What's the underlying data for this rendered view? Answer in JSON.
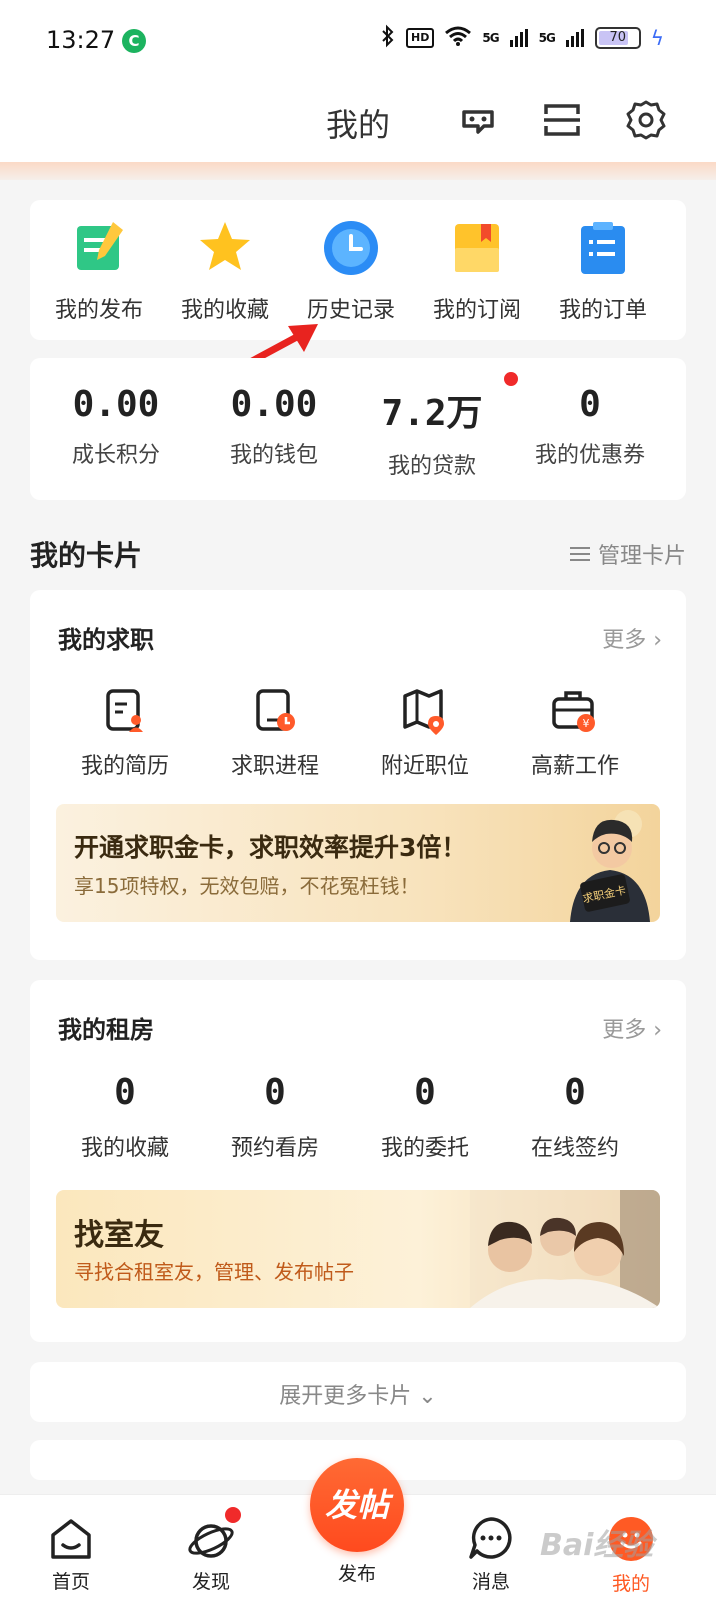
{
  "status_bar": {
    "time": "13:27",
    "app_badge": "C",
    "hd": "HD",
    "net1": "5G",
    "net2": "5G",
    "battery": "70"
  },
  "header": {
    "title": "我的",
    "icons": [
      "customer-service-icon",
      "scan-icon",
      "settings-icon"
    ]
  },
  "quick_actions": [
    {
      "label": "我的发布",
      "icon": "edit-note-icon"
    },
    {
      "label": "我的收藏",
      "icon": "star-icon"
    },
    {
      "label": "历史记录",
      "icon": "clock-icon"
    },
    {
      "label": "我的订阅",
      "icon": "bookmark-folder-icon"
    },
    {
      "label": "我的订单",
      "icon": "order-list-icon"
    }
  ],
  "stats": [
    {
      "value": "0.00",
      "label": "成长积分"
    },
    {
      "value": "0.00",
      "label": "我的钱包"
    },
    {
      "value": "7.2万",
      "label": "我的贷款"
    },
    {
      "value": "0",
      "label": "我的优惠券"
    }
  ],
  "cards_section": {
    "title": "我的卡片",
    "manage": "管理卡片"
  },
  "job_card": {
    "title": "我的求职",
    "more": "更多 ›",
    "items": [
      {
        "label": "我的简历",
        "icon": "resume-icon"
      },
      {
        "label": "求职进程",
        "icon": "progress-icon"
      },
      {
        "label": "附近职位",
        "icon": "map-pin-icon"
      },
      {
        "label": "高薪工作",
        "icon": "briefcase-icon"
      }
    ],
    "banner": {
      "title": "开通求职金卡，求职效率提升3倍！",
      "subtitle": "享15项特权，无效包赔，不花冤枉钱！",
      "card_text": "求职金卡"
    }
  },
  "rent_card": {
    "title": "我的租房",
    "more": "更多 ›",
    "items": [
      {
        "value": "0",
        "label": "我的收藏"
      },
      {
        "value": "0",
        "label": "预约看房"
      },
      {
        "value": "0",
        "label": "我的委托"
      },
      {
        "value": "0",
        "label": "在线签约"
      }
    ],
    "banner": {
      "title": "找室友",
      "subtitle": "寻找合租室友，管理、发布帖子"
    }
  },
  "expand": {
    "label": "展开更多卡片 ⌄"
  },
  "tabbar": {
    "publish": "发帖",
    "tabs": [
      {
        "label": "首页",
        "icon": "home-icon"
      },
      {
        "label": "发现",
        "icon": "planet-icon"
      },
      {
        "label": "发布",
        "icon": "publish-icon"
      },
      {
        "label": "消息",
        "icon": "message-icon"
      },
      {
        "label": "我的",
        "icon": "me-icon"
      }
    ]
  },
  "watermark": "Bai经验"
}
